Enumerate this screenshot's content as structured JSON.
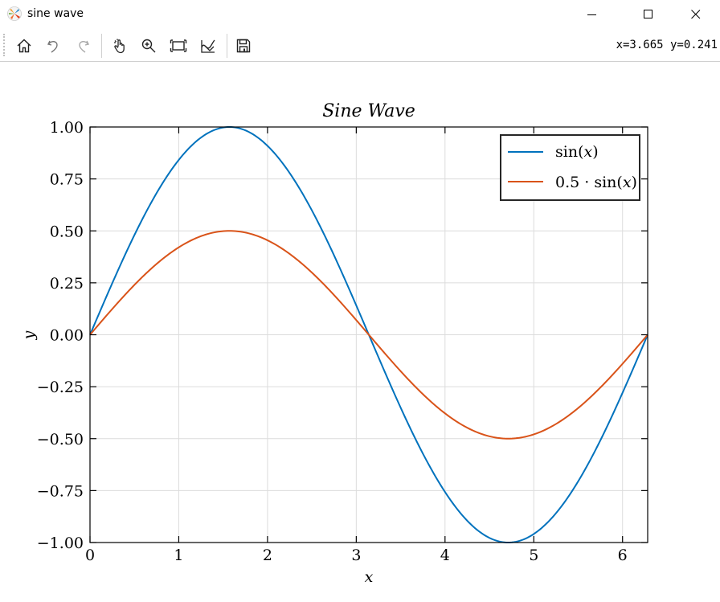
{
  "window": {
    "title": "sine wave",
    "app_icon": "matplotlib-logo-icon",
    "controls": {
      "minimize": "minimize-icon",
      "maximize": "maximize-icon",
      "close": "close-icon"
    }
  },
  "toolbar": {
    "buttons": [
      {
        "name": "home",
        "icon": "home-icon",
        "tooltip": "Reset original view"
      },
      {
        "name": "back",
        "icon": "undo-arrow-icon",
        "tooltip": "Back"
      },
      {
        "name": "forward",
        "icon": "redo-arrow-icon",
        "tooltip": "Forward"
      },
      {
        "name": "pan",
        "icon": "pan-hand-icon",
        "tooltip": "Pan"
      },
      {
        "name": "zoom",
        "icon": "zoom-magnifier-icon",
        "tooltip": "Zoom"
      },
      {
        "name": "subplots",
        "icon": "subplots-icon",
        "tooltip": "Configure subplots"
      },
      {
        "name": "customize",
        "icon": "axes-customize-icon",
        "tooltip": "Edit axis"
      },
      {
        "name": "save",
        "icon": "save-disk-icon",
        "tooltip": "Save"
      }
    ],
    "coordinates": "x=3.665 y=0.241"
  },
  "colors": {
    "series_1": "#0072BD",
    "series_2": "#D95319",
    "grid": "#dcdcdc",
    "axes": "#000000"
  },
  "chart_data": {
    "type": "line",
    "title": "Sine Wave",
    "xlabel": "x",
    "ylabel": "y",
    "xlim": [
      0,
      6.2832
    ],
    "ylim": [
      -1.0,
      1.0
    ],
    "xticks": [
      0,
      1,
      2,
      3,
      4,
      5,
      6
    ],
    "xtick_labels": [
      "0",
      "1",
      "2",
      "3",
      "4",
      "5",
      "6"
    ],
    "yticks": [
      -1.0,
      -0.75,
      -0.5,
      -0.25,
      0.0,
      0.25,
      0.5,
      0.75,
      1.0
    ],
    "ytick_labels": [
      "−1.00",
      "−0.75",
      "−0.50",
      "−0.25",
      "0.00",
      "0.25",
      "0.50",
      "0.75",
      "1.00"
    ],
    "grid": true,
    "legend_position": "top-right",
    "series": [
      {
        "name": "sin(x)",
        "label_html": "sin(<tspan font-style=\"italic\">x</tspan>)",
        "function": "sin",
        "amplitude": 1.0,
        "x": [
          0,
          0.7854,
          1.5708,
          2.3562,
          3.1416,
          3.927,
          4.7124,
          5.4978,
          6.2832
        ],
        "y": [
          0,
          0.7071,
          1.0,
          0.7071,
          0,
          -0.7071,
          -1.0,
          -0.7071,
          0
        ]
      },
      {
        "name": "0.5 · sin(x)",
        "function": "sin",
        "amplitude": 0.5,
        "x": [
          0,
          0.7854,
          1.5708,
          2.3562,
          3.1416,
          3.927,
          4.7124,
          5.4978,
          6.2832
        ],
        "y": [
          0,
          0.3536,
          0.5,
          0.3536,
          0,
          -0.3536,
          -0.5,
          -0.3536,
          0
        ]
      }
    ],
    "legend": {
      "entries": [
        "sin(x)",
        "0.5 · sin(x)"
      ]
    }
  }
}
